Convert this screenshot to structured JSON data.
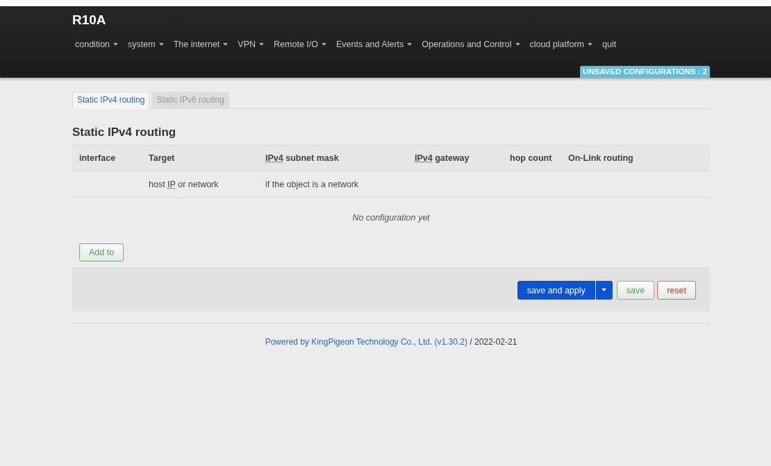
{
  "brand": "R10A",
  "menu": [
    {
      "label": "condition",
      "dropdown": true
    },
    {
      "label": "system",
      "dropdown": true
    },
    {
      "label": "The internet",
      "dropdown": true
    },
    {
      "label": "VPN",
      "dropdown": true
    },
    {
      "label": "Remote I/O",
      "dropdown": true
    },
    {
      "label": "Events and Alerts",
      "dropdown": true
    },
    {
      "label": "Operations and Control",
      "dropdown": true
    },
    {
      "label": "cloud platform",
      "dropdown": true
    },
    {
      "label": "quit",
      "dropdown": false
    }
  ],
  "badge": "UNSAVED CONFIGURATIONS : 2",
  "tabs": [
    {
      "label": "Static IPv4 routing",
      "selected": true
    },
    {
      "label": "Static IPv6 routing",
      "selected": false
    }
  ],
  "section_title": "Static IPv4 routing",
  "table": {
    "columns": [
      {
        "text": "interface"
      },
      {
        "text": "Target"
      },
      {
        "abbr": "IPv4",
        "text": " subnet mask"
      },
      {
        "abbr": "IPv4",
        "text": " gateway"
      },
      {
        "text": "hop count"
      },
      {
        "text": "On-Link routing"
      }
    ],
    "hint_row": {
      "target": {
        "before": "host ",
        "abbr": "IP",
        "text": " or network"
      },
      "subnet_mask": {
        "text": "if the object is a network"
      }
    },
    "empty": "No configuration yet"
  },
  "add_button": "Add to",
  "actions": [
    {
      "label": "save and apply",
      "kind": "primary"
    },
    {
      "label": "save",
      "kind": "positive"
    },
    {
      "label": "reset",
      "kind": "negative"
    }
  ],
  "footer": {
    "link": "Powered by KingPigeon Technology Co., Ltd. (v1.30.2)",
    "text": " / 2022-02-21"
  }
}
